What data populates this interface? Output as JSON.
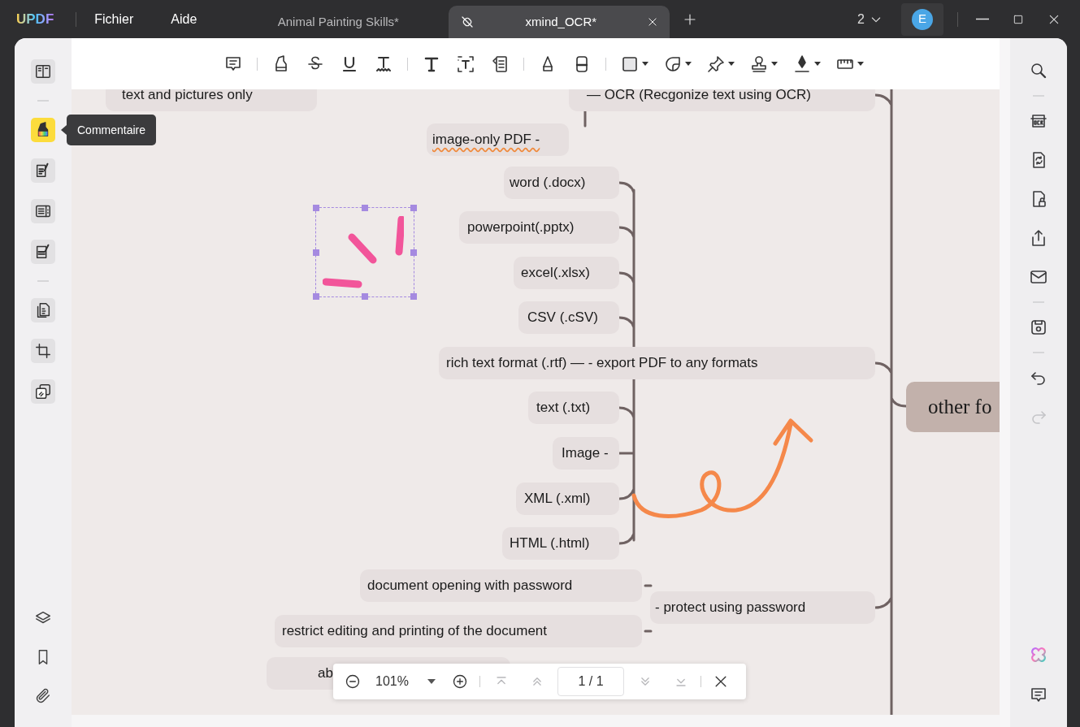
{
  "app": {
    "logo": "UPDF",
    "menu": [
      "Fichier",
      "Aide"
    ]
  },
  "tabs": [
    {
      "label": "Animal Painting Skills*",
      "selected": false
    },
    {
      "label": "xmind_OCR*",
      "selected": true
    }
  ],
  "window_count": "2",
  "account": {
    "initial": "E"
  },
  "left_sidebar": {
    "groups": [
      [
        {
          "kind": "reader",
          "selected": false
        }
      ],
      [
        {
          "kind": "comment",
          "selected": true
        },
        {
          "kind": "edit",
          "selected": false
        },
        {
          "kind": "form",
          "selected": false
        },
        {
          "kind": "redact",
          "selected": false
        }
      ],
      [
        {
          "kind": "pages",
          "selected": false
        },
        {
          "kind": "crop",
          "selected": false
        },
        {
          "kind": "organize",
          "selected": false
        }
      ]
    ],
    "bottom": [
      {
        "kind": "layers"
      },
      {
        "kind": "bookmark"
      },
      {
        "kind": "attachment"
      }
    ],
    "tooltip": "Commentaire"
  },
  "document": {
    "nodes": [
      {
        "text": "text and pictures only",
        "kind": "leaf",
        "misspelled": false
      },
      {
        "text": "— OCR (Recgonize text using OCR)",
        "kind": "leaf",
        "misspelled": false
      },
      {
        "text": "image-only PDF -",
        "kind": "leaf",
        "misspelled": true
      },
      {
        "text": "word (.docx)",
        "kind": "leaf",
        "misspelled": false
      },
      {
        "text": "powerpoint(.pptx)",
        "kind": "leaf",
        "misspelled": false
      },
      {
        "text": "excel(.xlsx)",
        "kind": "leaf",
        "misspelled": false
      },
      {
        "text": "CSV (.cSV)",
        "kind": "leaf",
        "misspelled": false
      },
      {
        "text": "rich text format (.rtf) — - export PDF to any formats",
        "kind": "leaf",
        "misspelled": false
      },
      {
        "text": "text (.txt)",
        "kind": "leaf",
        "misspelled": false
      },
      {
        "text": "Image -",
        "kind": "leaf",
        "misspelled": false
      },
      {
        "text": "XML (.xml)",
        "kind": "leaf",
        "misspelled": false
      },
      {
        "text": "HTML (.html)",
        "kind": "leaf",
        "misspelled": false
      },
      {
        "text": "document opening with password",
        "kind": "leaf",
        "misspelled": false
      },
      {
        "text": "- protect using password",
        "kind": "leaf",
        "misspelled": false
      },
      {
        "text": "restrict editing and printing of the document",
        "kind": "leaf",
        "misspelled": false
      },
      {
        "text": "ab",
        "kind": "leaf",
        "misspelled": false
      },
      {
        "text": "other fo",
        "kind": "topic",
        "misspelled": false
      }
    ]
  },
  "zoom_bar": {
    "zoom": "101%",
    "page": "1 / 1",
    "nav_disabled": true
  },
  "right_sidebar": {
    "groups": [
      [
        {
          "kind": "search",
          "disabled": false
        }
      ],
      [
        {
          "kind": "ocr",
          "disabled": false
        },
        {
          "kind": "convert",
          "disabled": false
        },
        {
          "kind": "protect",
          "disabled": false
        },
        {
          "kind": "share",
          "disabled": false
        },
        {
          "kind": "mail",
          "disabled": false
        }
      ],
      [
        {
          "kind": "save",
          "disabled": false
        }
      ],
      [
        {
          "kind": "undo",
          "disabled": false
        },
        {
          "kind": "redo",
          "disabled": true
        }
      ]
    ],
    "bottom": [
      {
        "kind": "ai"
      },
      {
        "kind": "comment"
      }
    ]
  }
}
